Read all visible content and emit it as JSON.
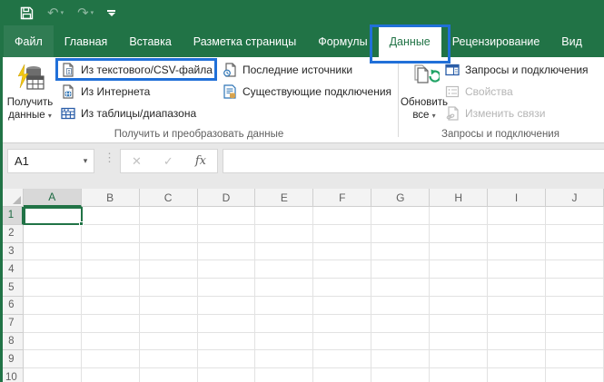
{
  "colors": {
    "excel_green": "#217346",
    "annotation_blue": "#2170d8",
    "icon_blue": "#2e75b6",
    "icon_yellow": "#f2c811",
    "refresh_green": "#21a366",
    "disabled_text": "#b5b5b5"
  },
  "icons": {
    "caret_down": "▾",
    "undo": "↶",
    "redo": "↷",
    "cancel": "✕",
    "enter": "✓",
    "fx": "fx",
    "grip": "⋮"
  },
  "tabs": {
    "active": "Данные",
    "items": [
      {
        "label": "Файл"
      },
      {
        "label": "Главная"
      },
      {
        "label": "Вставка"
      },
      {
        "label": "Разметка страницы"
      },
      {
        "label": "Формулы"
      },
      {
        "label": "Данные"
      },
      {
        "label": "Рецензирование"
      },
      {
        "label": "Вид"
      }
    ]
  },
  "ribbon": {
    "get_data_button": {
      "line1": "Получить",
      "line2": "данные"
    },
    "get_transform_group": {
      "buttons": [
        {
          "label": "Из текстового/CSV-файла",
          "highlighted": true
        },
        {
          "label": "Из Интернета"
        },
        {
          "label": "Из таблицы/диапазона"
        },
        {
          "label": "Последние источники"
        },
        {
          "label": "Существующие подключения"
        }
      ],
      "label": "Получить и преобразовать данные"
    },
    "refresh_all_button": {
      "line1": "Обновить",
      "line2": "все"
    },
    "queries_group": {
      "buttons": [
        {
          "label": "Запросы и подключения",
          "disabled": false
        },
        {
          "label": "Свойства",
          "disabled": true
        },
        {
          "label": "Изменить связи",
          "disabled": true
        }
      ],
      "label": "Запросы и подключения"
    }
  },
  "formula_bar": {
    "name_box_value": "A1",
    "formula_value": ""
  },
  "grid": {
    "selected_cell": "A1",
    "columns": [
      "A",
      "B",
      "C",
      "D",
      "E",
      "F",
      "G",
      "H",
      "I",
      "J"
    ],
    "rows": [
      "1",
      "2",
      "3",
      "4",
      "5",
      "6",
      "7",
      "8",
      "9",
      "10"
    ]
  }
}
